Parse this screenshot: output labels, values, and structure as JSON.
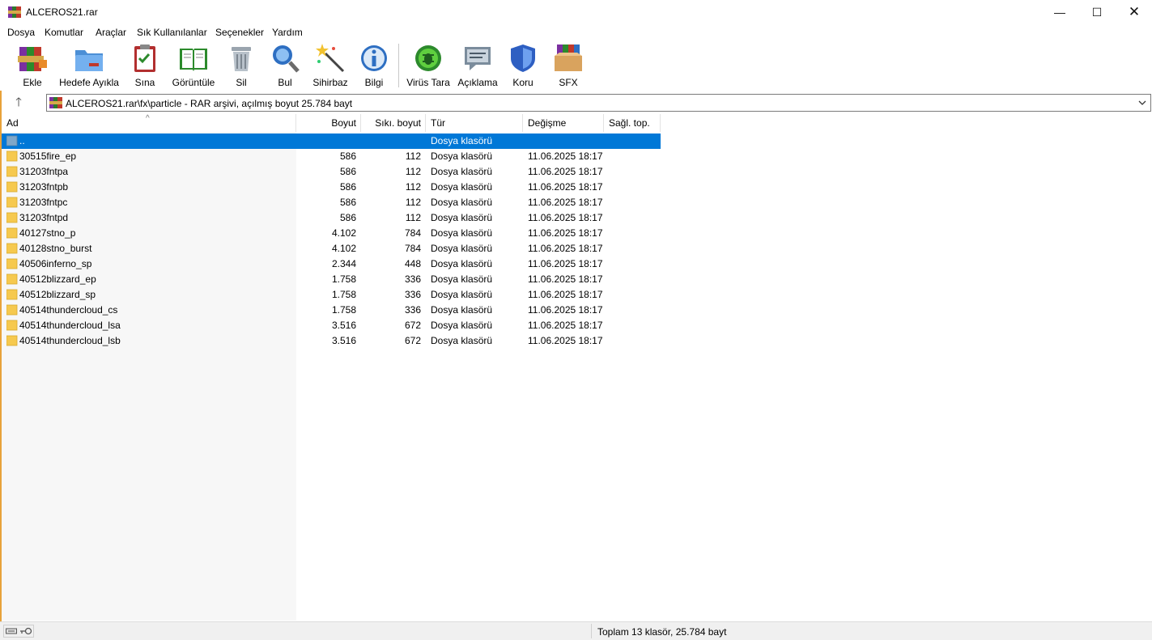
{
  "window": {
    "title": "ALCEROS21.rar",
    "minimize_glyph": "—",
    "maximize_glyph": "☐",
    "close_glyph": "✕"
  },
  "menu": [
    "Dosya",
    "Komutlar",
    "Araçlar",
    "Sık Kullanılanlar",
    "Seçenekler",
    "Yardım"
  ],
  "toolbar": [
    {
      "label": "Ekle",
      "icon": "add-books-icon"
    },
    {
      "label": "Hedefe Ayıkla",
      "icon": "extract-folder-icon"
    },
    {
      "label": "Sına",
      "icon": "test-clipboard-icon"
    },
    {
      "label": "Görüntüle",
      "icon": "view-book-icon"
    },
    {
      "label": "Sil",
      "icon": "trash-icon"
    },
    {
      "label": "Bul",
      "icon": "magnifier-icon"
    },
    {
      "label": "Sihirbaz",
      "icon": "wizard-wand-icon"
    },
    {
      "label": "Bilgi",
      "icon": "info-icon"
    },
    {
      "label": "Virüs Tara",
      "icon": "virus-scan-icon"
    },
    {
      "label": "Açıklama",
      "icon": "comment-icon"
    },
    {
      "label": "Koru",
      "icon": "shield-icon"
    },
    {
      "label": "SFX",
      "icon": "sfx-box-icon"
    }
  ],
  "address": {
    "path": "ALCEROS21.rar\\fx\\particle - RAR arşivi, açılmış boyut 25.784 bayt",
    "up_glyph": "🡑"
  },
  "columns": {
    "name": "Ad",
    "size": "Boyut",
    "packed": "Sıkı. boyut",
    "type": "Tür",
    "modified": "Değişme",
    "ratio": "Sağl. top."
  },
  "sort_caret": "^",
  "rows": [
    {
      "name": "..",
      "size": "",
      "packed": "",
      "type": "Dosya klasörü",
      "modified": "",
      "selected": true,
      "parent": true
    },
    {
      "name": "30515fire_ep",
      "size": "586",
      "packed": "112",
      "type": "Dosya klasörü",
      "modified": "11.06.2025 18:17"
    },
    {
      "name": "31203fntpa",
      "size": "586",
      "packed": "112",
      "type": "Dosya klasörü",
      "modified": "11.06.2025 18:17"
    },
    {
      "name": "31203fntpb",
      "size": "586",
      "packed": "112",
      "type": "Dosya klasörü",
      "modified": "11.06.2025 18:17"
    },
    {
      "name": "31203fntpc",
      "size": "586",
      "packed": "112",
      "type": "Dosya klasörü",
      "modified": "11.06.2025 18:17"
    },
    {
      "name": "31203fntpd",
      "size": "586",
      "packed": "112",
      "type": "Dosya klasörü",
      "modified": "11.06.2025 18:17"
    },
    {
      "name": "40127stno_p",
      "size": "4.102",
      "packed": "784",
      "type": "Dosya klasörü",
      "modified": "11.06.2025 18:17"
    },
    {
      "name": "40128stno_burst",
      "size": "4.102",
      "packed": "784",
      "type": "Dosya klasörü",
      "modified": "11.06.2025 18:17"
    },
    {
      "name": "40506inferno_sp",
      "size": "2.344",
      "packed": "448",
      "type": "Dosya klasörü",
      "modified": "11.06.2025 18:17"
    },
    {
      "name": "40512blizzard_ep",
      "size": "1.758",
      "packed": "336",
      "type": "Dosya klasörü",
      "modified": "11.06.2025 18:17"
    },
    {
      "name": "40512blizzard_sp",
      "size": "1.758",
      "packed": "336",
      "type": "Dosya klasörü",
      "modified": "11.06.2025 18:17"
    },
    {
      "name": "40514thundercloud_cs",
      "size": "1.758",
      "packed": "336",
      "type": "Dosya klasörü",
      "modified": "11.06.2025 18:17"
    },
    {
      "name": "40514thundercloud_lsa",
      "size": "3.516",
      "packed": "672",
      "type": "Dosya klasörü",
      "modified": "11.06.2025 18:17"
    },
    {
      "name": "40514thundercloud_lsb",
      "size": "3.516",
      "packed": "672",
      "type": "Dosya klasörü",
      "modified": "11.06.2025 18:17"
    }
  ],
  "status": {
    "summary": "Toplam 13 klasör, 25.784 bayt"
  },
  "colors": {
    "selection": "#0078d7",
    "folder": "#f6c94e",
    "accent_border": "#e8a23a"
  }
}
